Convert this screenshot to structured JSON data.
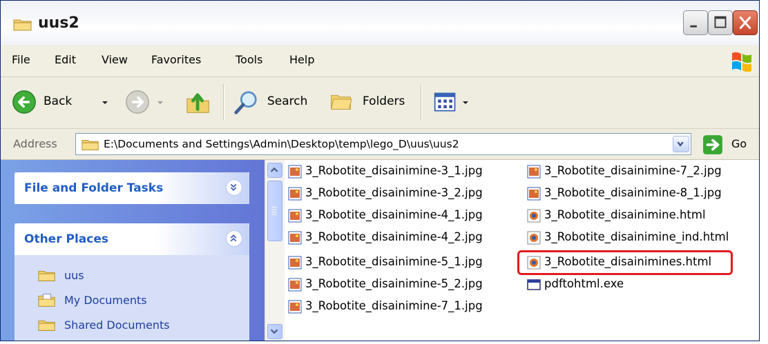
{
  "window": {
    "title": "uus2"
  },
  "menu": [
    "File",
    "Edit",
    "View",
    "Favorites",
    "Tools",
    "Help"
  ],
  "toolbar": {
    "back_label": "Back",
    "search_label": "Search",
    "folders_label": "Folders"
  },
  "address": {
    "label": "Address",
    "path": "E:\\Documents and Settings\\Admin\\Desktop\\temp\\lego_D\\uus\\uus2",
    "go_label": "Go"
  },
  "taskpane": {
    "file_folder_tasks": "File and Folder Tasks",
    "other_places": "Other Places",
    "places": [
      "uus",
      "My Documents",
      "Shared Documents"
    ]
  },
  "files": [
    {
      "name": "3_Robotite_disainimine-3_1.jpg",
      "type": "jpg"
    },
    {
      "name": "3_Robotite_disainimine-3_2.jpg",
      "type": "jpg"
    },
    {
      "name": "3_Robotite_disainimine-4_1.jpg",
      "type": "jpg"
    },
    {
      "name": "3_Robotite_disainimine-4_2.jpg",
      "type": "jpg"
    },
    {
      "name": "3_Robotite_disainimine-5_1.jpg",
      "type": "jpg"
    },
    {
      "name": "3_Robotite_disainimine-5_2.jpg",
      "type": "jpg"
    },
    {
      "name": "3_Robotite_disainimine-7_1.jpg",
      "type": "jpg"
    },
    {
      "name": "3_Robotite_disainimine-7_2.jpg",
      "type": "jpg"
    },
    {
      "name": "3_Robotite_disainimine-8_1.jpg",
      "type": "jpg"
    },
    {
      "name": "3_Robotite_disainimine.html",
      "type": "html"
    },
    {
      "name": "3_Robotite_disainimine_ind.html",
      "type": "html"
    },
    {
      "name": "3_Robotite_disainimines.html",
      "type": "html",
      "highlighted": true
    },
    {
      "name": "pdftohtml.exe",
      "type": "exe"
    }
  ],
  "colors": {
    "highlight": "#e21b1b",
    "taskpane_link": "#215dc6"
  }
}
